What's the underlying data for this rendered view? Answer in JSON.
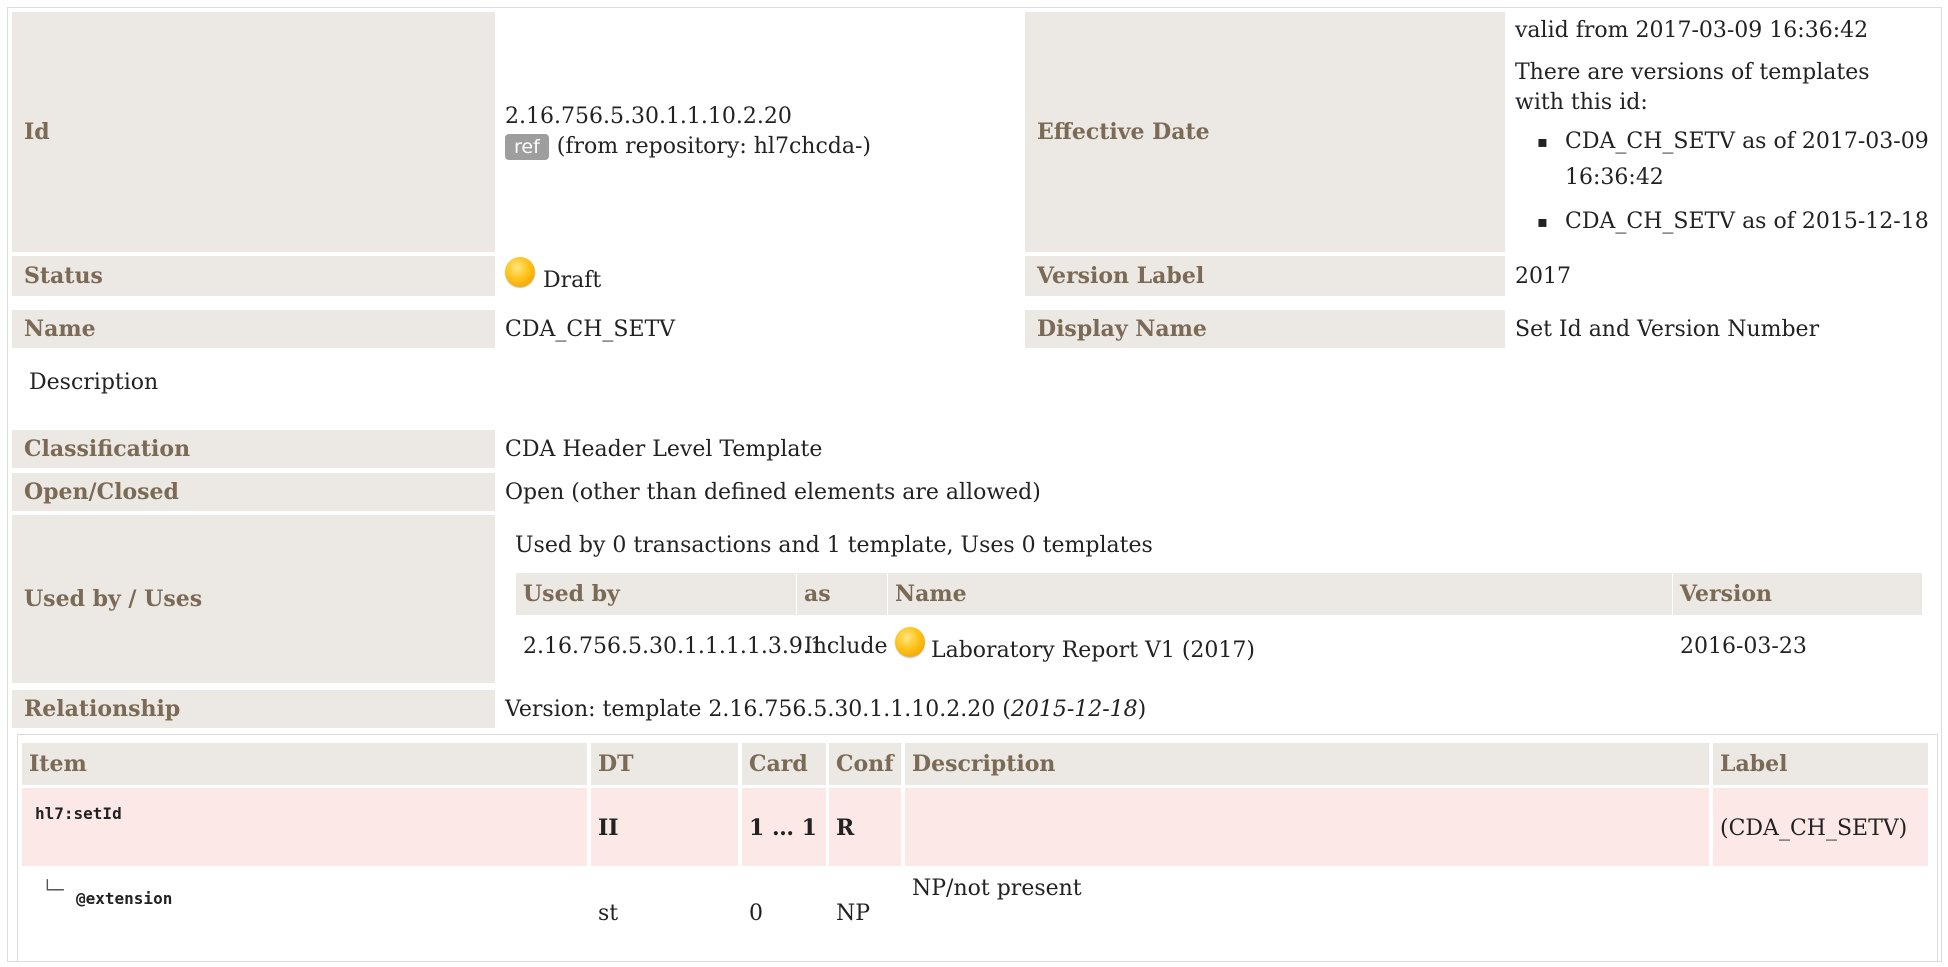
{
  "meta": {
    "id_label": "Id",
    "id_value": "2.16.756.5.30.1.1.10.2.20",
    "ref_badge": "ref",
    "repository": "(from repository: hl7chcda-)",
    "effective_date_label": "Effective Date",
    "valid_from": "valid from 2017-03-09 16:36:42",
    "versions_note": "There are versions of templates with this id:",
    "versions": [
      "CDA_CH_SETV as of 2017-03-09 16:36:42",
      "CDA_CH_SETV as of 2015-12-18"
    ],
    "status_label": "Status",
    "status_value": "Draft",
    "version_label_label": "Version Label",
    "version_label_value": "2017",
    "name_label": "Name",
    "name_value": "CDA_CH_SETV",
    "display_name_label": "Display Name",
    "display_name_value": "Set Id and Version Number",
    "description_label": "Description",
    "classification_label": "Classification",
    "classification_value": "CDA Header Level Template",
    "open_closed_label": "Open/Closed",
    "open_closed_value": "Open (other than defined elements are allowed)",
    "used_by_label": "Used by / Uses",
    "used_by_summary": "Used by 0 transactions and 1 template, Uses 0 templates",
    "relationship_label": "Relationship",
    "relationship_prefix": "Version: template 2.16.756.5.30.1.1.10.2.20 (",
    "relationship_date": "2015-12-18",
    "relationship_suffix": ")"
  },
  "used_by_table": {
    "headers": [
      "Used by",
      "as",
      "Name",
      "Version"
    ],
    "rows": [
      {
        "id": "2.16.756.5.30.1.1.1.1.3.9.1",
        "as": "Include",
        "name": "Laboratory Report V1 (2017)",
        "version": "2016-03-23"
      }
    ]
  },
  "items_table": {
    "headers": [
      "Item",
      "DT",
      "Card",
      "Conf",
      "Description",
      "Label"
    ],
    "rows": [
      {
        "item": "hl7:setId",
        "dt": "II",
        "card": "1 … 1",
        "conf": "R",
        "description": "",
        "label": "(CDA_CH_SETV)"
      },
      {
        "tree": "└─",
        "item": "@extension",
        "dt": "st",
        "card": "0",
        "conf": "NP",
        "description": "NP/not present",
        "label": ""
      }
    ]
  },
  "colors": {
    "label_bg": "#ece8e3",
    "label_text": "#7b6a55",
    "required_row_bg": "#fde8e8",
    "status_draft": "#ffc21a"
  }
}
